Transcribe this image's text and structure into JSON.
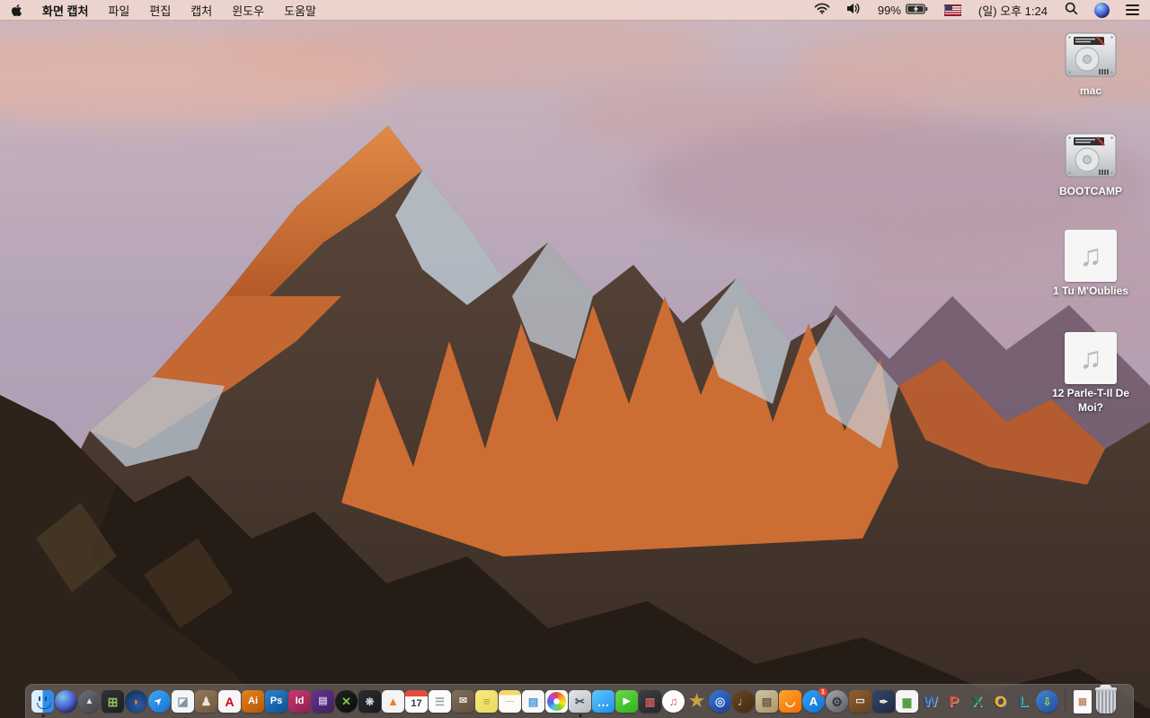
{
  "menubar": {
    "apple_logo": "apple-icon",
    "app_name": "화면 캡처",
    "menus": [
      "파일",
      "편집",
      "캡처",
      "윈도우",
      "도움말"
    ],
    "status": {
      "icons": [
        "wifi",
        "volume",
        "battery-charging",
        "us-flag",
        "spotlight-search",
        "siri",
        "notification-center"
      ],
      "battery_percent": "99%",
      "clock": "(일) 오후 1:24"
    }
  },
  "desktop": {
    "icons": [
      {
        "type": "drive",
        "name": "hard-drive-mac",
        "label": "mac"
      },
      {
        "type": "drive",
        "name": "hard-drive-bootcamp",
        "label": "BOOTCAMP"
      },
      {
        "type": "audio",
        "name": "audio-file-1",
        "label": "1 Tu M'Oublies",
        "glyph": "♫"
      },
      {
        "type": "audio",
        "name": "audio-file-12",
        "label": "12 Parle-T-Il De Moi?",
        "glyph": "♫"
      }
    ]
  },
  "dock": {
    "apps": [
      {
        "name": "finder",
        "special": "finder",
        "running": true
      },
      {
        "name": "siri",
        "round": true,
        "bgcss": "radial-gradient(circle at 35% 30%, #7ec6f2, #4a5fd0 50%, #191a38 85%)",
        "glyph": ""
      },
      {
        "name": "launchpad",
        "round": true,
        "bg": "#6a6f75",
        "bg2": "#3f4348",
        "glyph": "▲",
        "fg": "#dfe2e6",
        "fs": 10
      },
      {
        "name": "mission-control",
        "bg": "#303236",
        "bg2": "#1d1f22",
        "glyph": "⊞",
        "fg": "#8fc25a",
        "fs": 14
      },
      {
        "name": "firefox",
        "round": true,
        "bgcss": "radial-gradient(circle at 60% 65%, #2a5ca8, #12335f 80%)",
        "glyph": "◗",
        "fg": "#f07c1a",
        "fs": 13
      },
      {
        "name": "safari",
        "round": true,
        "bg": "#41aaf2",
        "bg2": "#1370d2",
        "glyph": "➤",
        "fg": "#ffffff",
        "fs": 10,
        "rot": -45
      },
      {
        "name": "preview",
        "bg": "#f4f5f6",
        "glyph": "◪",
        "fg": "#7f96ac",
        "fs": 13
      },
      {
        "name": "contacts",
        "bg": "#96795a",
        "bg2": "#6d563e",
        "glyph": "♟",
        "fg": "#ece4d6",
        "fs": 13
      },
      {
        "name": "acrobat-reader",
        "bg": "#f6f6f6",
        "glyph": "A",
        "fg": "#d0021b",
        "fs": 14
      },
      {
        "name": "adobe-illustrator",
        "bg": "#e8821f",
        "bg2": "#b35708",
        "glyph": "Ai",
        "fg": "#ffffff",
        "fs": 11
      },
      {
        "name": "adobe-photoshop",
        "bg": "#2a84cf",
        "bg2": "#0f4f92",
        "glyph": "Ps",
        "fg": "#ffffff",
        "fs": 11
      },
      {
        "name": "adobe-indesign",
        "bg": "#c63a72",
        "bg2": "#8c1f50",
        "glyph": "Id",
        "fg": "#ffffff",
        "fs": 11
      },
      {
        "name": "toast-titanium",
        "bg": "#63348f",
        "bg2": "#40205f",
        "glyph": "▤",
        "fg": "#cdb9e6",
        "fs": 11
      },
      {
        "name": "video-converter-x",
        "round": true,
        "bg": "#222222",
        "bg2": "#0c0c0c",
        "glyph": "✕",
        "fg": "#84c43e",
        "fs": 13
      },
      {
        "name": "fan-utility",
        "bg": "#2b2d31",
        "bg2": "#1a1b1e",
        "glyph": "❋",
        "fg": "#d2d6db",
        "fs": 12
      },
      {
        "name": "vlc",
        "bg": "#f4f4f4",
        "glyph": "▲",
        "fg": "#ef7d1d",
        "fs": 13
      },
      {
        "name": "calendar",
        "special": "calendar",
        "day": "17"
      },
      {
        "name": "reminders",
        "bg": "#fcfcfc",
        "glyph": "☰",
        "fg": "#9aa0a6",
        "fs": 12
      },
      {
        "name": "mail-archive-box",
        "bg": "#83705a",
        "bg2": "#5e4e3d",
        "glyph": "✉",
        "fg": "#eee7db",
        "fs": 11
      },
      {
        "name": "stickies",
        "bg": "#f7ea7d",
        "bg2": "#e9da5e",
        "glyph": "≡",
        "fg": "#b4a23d",
        "fs": 13
      },
      {
        "name": "notes",
        "bgcss": "linear-gradient(180deg,#f0d968 0 22%,#fcfcf5 22%)",
        "glyph": "—",
        "fg": "#c9c9c0",
        "fs": 9
      },
      {
        "name": "colorsync-document",
        "bg": "#f8f8f8",
        "glyph": "▤",
        "fg": "#4a90d9",
        "fs": 12
      },
      {
        "name": "photos",
        "special": "photos"
      },
      {
        "name": "grab-screen-capture",
        "bg": "#e3e7ec",
        "bg2": "#b5bcc5",
        "glyph": "✂",
        "fg": "#474b52",
        "fs": 13,
        "running": true
      },
      {
        "name": "messages",
        "bg": "#5fc7f7",
        "bg2": "#1f8ef0",
        "glyph": "…",
        "fg": "#ffffff",
        "fs": 14
      },
      {
        "name": "facetime",
        "bg": "#6cd84c",
        "bg2": "#2cb31c",
        "glyph": "▶",
        "fg": "#ffffff",
        "fs": 10
      },
      {
        "name": "photo-booth",
        "bg": "#3c3f45",
        "bg2": "#24262a",
        "glyph": "▥",
        "fg": "#d86060",
        "fs": 12
      },
      {
        "name": "itunes",
        "round": true,
        "bg": "#fdfdfd",
        "glyph": "♫",
        "fg": "#e8457e",
        "fs": 13
      },
      {
        "name": "imovie",
        "glyph": "★",
        "fg": "#c9a23c",
        "fs": 19,
        "flat": true
      },
      {
        "name": "idvd",
        "round": true,
        "bg": "#3a79dc",
        "bg2": "#173f8f",
        "glyph": "◎",
        "fg": "#d6e4fa",
        "fs": 13
      },
      {
        "name": "garageband",
        "round": true,
        "bg": "#6b4722",
        "bg2": "#432a10",
        "glyph": "♩",
        "fg": "#ecd3a4",
        "fs": 13
      },
      {
        "name": "newsstand",
        "bg": "#d2c4a4",
        "bg2": "#ab9468",
        "glyph": "▤",
        "fg": "#635840",
        "fs": 12
      },
      {
        "name": "ibooks",
        "bg": "#ffa42e",
        "bg2": "#f26e00",
        "glyph": "◡",
        "fg": "#ffffff",
        "fs": 13
      },
      {
        "name": "app-store",
        "round": true,
        "bg": "#35a3f6",
        "bg2": "#0c6fd6",
        "glyph": "A",
        "fg": "#ffffff",
        "fs": 13,
        "badge": "1"
      },
      {
        "name": "system-preferences",
        "round": true,
        "bg": "#a3a6ab",
        "bg2": "#5a5d62",
        "glyph": "⚙",
        "fg": "#323539",
        "fs": 14
      },
      {
        "name": "keynote",
        "bg": "#915f33",
        "bg2": "#64401e",
        "glyph": "▭",
        "fg": "#efe8dc",
        "fs": 11
      },
      {
        "name": "pages",
        "bg": "#35476a",
        "bg2": "#1e2a45",
        "glyph": "✒",
        "fg": "#eae6da",
        "fs": 12
      },
      {
        "name": "numbers",
        "bg": "#f5f5f5",
        "glyph": "▆",
        "fg": "#57a045",
        "fs": 12
      },
      {
        "name": "ms-word",
        "glyph": "W",
        "fg": "#2b5ea7",
        "fs": 17,
        "letter": true,
        "flat": true
      },
      {
        "name": "ms-powerpoint",
        "glyph": "P",
        "fg": "#d04727",
        "fs": 17,
        "letter": true,
        "flat": true
      },
      {
        "name": "ms-excel",
        "glyph": "X",
        "fg": "#1e7145",
        "fs": 17,
        "letter": true,
        "flat": true
      },
      {
        "name": "ms-outlook",
        "glyph": "O",
        "fg": "#e8b325",
        "fs": 17,
        "letter": true,
        "flat": true
      },
      {
        "name": "ms-lync",
        "glyph": "L",
        "fg": "#0f7c8c",
        "fs": 17,
        "letter": true,
        "flat": true
      },
      {
        "name": "internet-downloader",
        "round": true,
        "bg": "#4584d6",
        "bg2": "#1d4d9c",
        "glyph": "⇩",
        "fg": "#8ed23f",
        "fs": 12
      }
    ],
    "files": [
      {
        "name": "image-file-document",
        "special": "file-doc",
        "glyph": "▦",
        "fg": "#b06838",
        "fs": 11
      },
      {
        "name": "trash-full",
        "special": "trash"
      }
    ]
  },
  "colors": {
    "menubar_tint": "#eed6cf",
    "dock_tint": "#878080",
    "sky_top": "#cbb8c0",
    "sunlit_rock": "#cc6d33",
    "shadow_rock": "#4a392f",
    "snow": "#c5cfda",
    "foreground_rock": "#251c15",
    "badge_red": "#e8453c"
  }
}
